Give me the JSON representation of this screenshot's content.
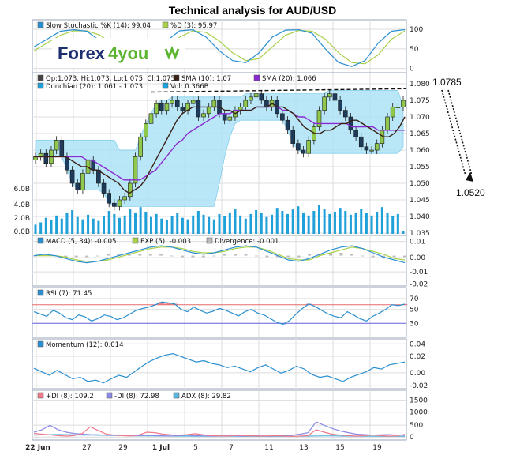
{
  "title": "Technical analysis for AUD/USD",
  "logo": {
    "part1": "Forex",
    "part2": "4you"
  },
  "annotations": {
    "upper": "1.0785",
    "lower": "1.0520"
  },
  "x_tick_labels": [
    "22 Jun",
    "27",
    "29",
    "1 Jul",
    "5",
    "7",
    "11",
    "13",
    "15",
    "19"
  ],
  "colors": {
    "bull": "#8fc84a",
    "bear": "#1f3b5b",
    "donchian": "#aee3f7",
    "sma10": "#3a2016",
    "sma20": "#8a2ad0",
    "volume": "#20a0d8",
    "grid": "#dcdcdc",
    "panel_border": "#9aa6b8",
    "k_line": "#2a8fd0",
    "d_line": "#a8d04a",
    "rsi_line": "#2a8fd0",
    "rsi_over": "#e66a6a",
    "rsi_under": "#6a6ae6",
    "plus_di": "#f07a8a",
    "minus_di": "#8a8ae6",
    "adx": "#5ab8e0"
  },
  "chart_data": [
    {
      "id": "stochastic",
      "type": "line",
      "legend": [
        "Slow Stochastic %K (14): 99.04",
        "%D (3): 95.97"
      ],
      "ylim": [
        0,
        100
      ],
      "y_ticks": [
        "100",
        "50",
        "0"
      ],
      "series": [
        {
          "name": "Slow Stochastic %K (14)",
          "values": [
            55,
            75,
            95,
            99,
            95,
            70,
            35,
            10,
            8,
            30,
            70,
            96,
            99,
            80,
            45,
            20,
            15,
            40,
            80,
            98,
            99,
            90,
            50,
            15,
            5,
            20,
            65,
            95,
            99.04
          ]
        },
        {
          "name": "%D (3)",
          "values": [
            45,
            65,
            85,
            96,
            96,
            85,
            60,
            30,
            15,
            20,
            45,
            80,
            96,
            92,
            70,
            40,
            20,
            25,
            55,
            85,
            97,
            95,
            75,
            40,
            15,
            12,
            35,
            75,
            95.97
          ]
        }
      ]
    },
    {
      "id": "price",
      "type": "candlestick",
      "legend": [
        "Op:1.073, Hi:1.073, Lo:1.075, Cl:1.075",
        "SMA (10): 1.07",
        "SMA (20): 1.066",
        "Donchian (20): 1.061 - 1.073",
        "Vol: 0.366B"
      ],
      "ylim": [
        1.035,
        1.08
      ],
      "y_ticks": [
        "1.080",
        "1.075",
        "1.070",
        "1.065",
        "1.060",
        "1.055",
        "1.050",
        "1.045",
        "1.040",
        "1.035"
      ],
      "volume_ticks": [
        "6.0B",
        "4.0B",
        "2.0B",
        "0.0B"
      ],
      "close": [
        1.058,
        1.059,
        1.056,
        1.06,
        1.063,
        1.058,
        1.054,
        1.05,
        1.048,
        1.053,
        1.057,
        1.054,
        1.05,
        1.047,
        1.044,
        1.043,
        1.045,
        1.046,
        1.05,
        1.058,
        1.064,
        1.068,
        1.071,
        1.074,
        1.072,
        1.074,
        1.075,
        1.073,
        1.072,
        1.074,
        1.075,
        1.07,
        1.071,
        1.073,
        1.075,
        1.071,
        1.069,
        1.07,
        1.072,
        1.073,
        1.075,
        1.076,
        1.077,
        1.075,
        1.073,
        1.075,
        1.071,
        1.069,
        1.066,
        1.062,
        1.06,
        1.059,
        1.063,
        1.067,
        1.072,
        1.076,
        1.077,
        1.075,
        1.072,
        1.07,
        1.066,
        1.064,
        1.061,
        1.06,
        1.06,
        1.062,
        1.066,
        1.07,
        1.073,
        1.073,
        1.075
      ],
      "sma10": [
        1.058,
        1.058,
        1.058,
        1.058,
        1.058,
        1.058,
        1.058,
        1.057,
        1.056,
        1.055,
        1.055,
        1.054,
        1.054,
        1.053,
        1.052,
        1.051,
        1.05,
        1.048,
        1.047,
        1.048,
        1.049,
        1.051,
        1.054,
        1.057,
        1.06,
        1.063,
        1.066,
        1.069,
        1.071,
        1.072,
        1.073,
        1.073,
        1.073,
        1.073,
        1.073,
        1.073,
        1.072,
        1.072,
        1.071,
        1.072,
        1.072,
        1.072,
        1.073,
        1.073,
        1.073,
        1.074,
        1.073,
        1.073,
        1.072,
        1.071,
        1.069,
        1.067,
        1.066,
        1.065,
        1.065,
        1.066,
        1.066,
        1.067,
        1.068,
        1.068,
        1.069,
        1.069,
        1.068,
        1.067,
        1.066,
        1.065,
        1.064,
        1.064,
        1.065,
        1.067,
        1.07
      ],
      "sma20": [
        1.058,
        1.058,
        1.058,
        1.058,
        1.058,
        1.058,
        1.058,
        1.058,
        1.058,
        1.058,
        1.057,
        1.057,
        1.056,
        1.055,
        1.054,
        1.053,
        1.052,
        1.051,
        1.051,
        1.051,
        1.051,
        1.052,
        1.053,
        1.054,
        1.056,
        1.058,
        1.06,
        1.062,
        1.063,
        1.065,
        1.066,
        1.067,
        1.068,
        1.069,
        1.07,
        1.071,
        1.071,
        1.071,
        1.072,
        1.072,
        1.072,
        1.072,
        1.073,
        1.073,
        1.073,
        1.073,
        1.073,
        1.072,
        1.072,
        1.071,
        1.07,
        1.07,
        1.069,
        1.068,
        1.068,
        1.068,
        1.068,
        1.068,
        1.068,
        1.068,
        1.067,
        1.067,
        1.067,
        1.067,
        1.067,
        1.066,
        1.066,
        1.066,
        1.066,
        1.066,
        1.066
      ],
      "donchian_upper": [
        1.063,
        1.063,
        1.063,
        1.063,
        1.063,
        1.063,
        1.063,
        1.063,
        1.063,
        1.063,
        1.063,
        1.063,
        1.063,
        1.063,
        1.063,
        1.063,
        1.06,
        1.06,
        1.06,
        1.06,
        1.064,
        1.068,
        1.071,
        1.074,
        1.075,
        1.075,
        1.076,
        1.076,
        1.076,
        1.076,
        1.076,
        1.076,
        1.076,
        1.076,
        1.076,
        1.076,
        1.076,
        1.076,
        1.076,
        1.076,
        1.077,
        1.077,
        1.077,
        1.077,
        1.077,
        1.077,
        1.077,
        1.077,
        1.077,
        1.077,
        1.077,
        1.077,
        1.077,
        1.077,
        1.077,
        1.077,
        1.078,
        1.078,
        1.078,
        1.078,
        1.078,
        1.078,
        1.078,
        1.078,
        1.078,
        1.078,
        1.078,
        1.078,
        1.078,
        1.078,
        1.073
      ],
      "donchian_lower": [
        1.058,
        1.058,
        1.058,
        1.058,
        1.058,
        1.058,
        1.054,
        1.05,
        1.048,
        1.048,
        1.048,
        1.048,
        1.048,
        1.047,
        1.044,
        1.043,
        1.043,
        1.043,
        1.043,
        1.043,
        1.043,
        1.043,
        1.043,
        1.043,
        1.043,
        1.043,
        1.043,
        1.043,
        1.043,
        1.043,
        1.043,
        1.043,
        1.043,
        1.043,
        1.043,
        1.05,
        1.058,
        1.064,
        1.068,
        1.069,
        1.069,
        1.069,
        1.069,
        1.069,
        1.069,
        1.069,
        1.069,
        1.069,
        1.066,
        1.062,
        1.06,
        1.059,
        1.059,
        1.059,
        1.059,
        1.059,
        1.059,
        1.059,
        1.059,
        1.059,
        1.059,
        1.059,
        1.059,
        1.059,
        1.059,
        1.059,
        1.059,
        1.059,
        1.059,
        1.059,
        1.061
      ],
      "volume": [
        1.2,
        1.5,
        2.1,
        1.8,
        2.4,
        2.0,
        2.8,
        3.1,
        2.2,
        1.9,
        2.5,
        2.0,
        1.7,
        2.3,
        3.0,
        2.6,
        2.1,
        2.4,
        3.2,
        2.8,
        3.5,
        2.9,
        2.2,
        2.6,
        2.0,
        1.8,
        2.3,
        2.7,
        2.1,
        1.9,
        2.4,
        3.0,
        2.5,
        2.2,
        1.9,
        2.6,
        2.3,
        2.8,
        3.2,
        2.4,
        2.0,
        2.6,
        3.1,
        2.7,
        2.2,
        2.5,
        3.4,
        3.0,
        2.6,
        3.2,
        3.6,
        2.8,
        2.4,
        3.0,
        3.8,
        3.2,
        2.6,
        2.9,
        3.4,
        3.0,
        2.5,
        2.8,
        3.3,
        2.7,
        2.4,
        2.9,
        3.5,
        2.8,
        2.3,
        2.6,
        0.366
      ]
    },
    {
      "id": "macd",
      "type": "line",
      "legend": [
        "MACD (5, 34): -0.005",
        "EXP (5): -0.003",
        "Divergence: -0.001"
      ],
      "ylim": [
        -0.02,
        0.01
      ],
      "y_ticks": [
        "0.01",
        "0.00",
        "-0.01",
        "-0.02"
      ],
      "series": [
        {
          "name": "MACD (5, 34)",
          "values": [
            0.0,
            0.001,
            0.0,
            -0.002,
            -0.004,
            -0.005,
            -0.004,
            -0.002,
            0.0,
            0.002,
            0.004,
            0.006,
            0.007,
            0.006,
            0.004,
            0.002,
            0.001,
            0.002,
            0.004,
            0.006,
            0.007,
            0.006,
            0.003,
            0.0,
            -0.003,
            -0.004,
            -0.002,
            0.001,
            0.004,
            0.006,
            0.007,
            0.005,
            0.002,
            -0.001,
            -0.003,
            -0.005
          ]
        },
        {
          "name": "EXP (5)",
          "values": [
            0.0,
            0.0,
            0.0,
            -0.001,
            -0.003,
            -0.004,
            -0.004,
            -0.003,
            -0.001,
            0.001,
            0.003,
            0.005,
            0.006,
            0.006,
            0.005,
            0.003,
            0.002,
            0.002,
            0.003,
            0.005,
            0.006,
            0.006,
            0.004,
            0.001,
            -0.002,
            -0.003,
            -0.003,
            0.0,
            0.002,
            0.004,
            0.006,
            0.005,
            0.003,
            0.001,
            -0.002,
            -0.003
          ]
        },
        {
          "name": "Divergence",
          "values": [
            0.0,
            0.001,
            0.0,
            -0.001,
            -0.001,
            -0.001,
            0.0,
            0.001,
            0.001,
            0.001,
            0.001,
            0.001,
            0.001,
            0.0,
            -0.001,
            -0.001,
            -0.001,
            0.0,
            0.001,
            0.001,
            0.001,
            0.0,
            -0.001,
            -0.001,
            -0.001,
            -0.001,
            0.001,
            0.001,
            0.002,
            0.002,
            0.001,
            0.0,
            -0.001,
            -0.002,
            -0.001,
            -0.001
          ]
        }
      ]
    },
    {
      "id": "rsi",
      "type": "line",
      "legend": [
        "RSI (7): 71.45"
      ],
      "ylim": [
        10,
        90
      ],
      "y_ticks": [
        "70",
        "50",
        "30"
      ],
      "levels": [
        70,
        30
      ],
      "series": [
        {
          "name": "RSI (7)",
          "values": [
            55,
            50,
            45,
            58,
            52,
            42,
            38,
            48,
            44,
            35,
            40,
            48,
            45,
            38,
            42,
            50,
            58,
            62,
            65,
            70,
            76,
            74,
            72,
            60,
            55,
            65,
            58,
            52,
            56,
            62,
            58,
            52,
            46,
            55,
            60,
            52,
            48,
            40,
            32,
            28,
            36,
            50,
            62,
            72,
            66,
            58,
            50,
            45,
            42,
            55,
            48,
            40,
            35,
            45,
            52,
            60,
            70,
            68,
            71.45
          ]
        }
      ]
    },
    {
      "id": "momentum",
      "type": "line",
      "legend": [
        "Momentum (12): 0.014"
      ],
      "ylim": [
        -0.02,
        0.04
      ],
      "y_ticks": [
        "0.04",
        "0.02",
        "0.00",
        "-0.02"
      ],
      "series": [
        {
          "name": "Momentum (12)",
          "values": [
            0.005,
            0.0,
            -0.005,
            0.002,
            -0.004,
            -0.01,
            -0.008,
            -0.014,
            -0.012,
            -0.016,
            -0.01,
            -0.005,
            -0.008,
            0.0,
            0.008,
            0.015,
            0.02,
            0.024,
            0.026,
            0.022,
            0.018,
            0.014,
            0.016,
            0.012,
            0.01,
            0.006,
            0.008,
            0.004,
            0.0,
            0.006,
            0.01,
            0.004,
            -0.002,
            0.002,
            0.008,
            0.004,
            -0.004,
            -0.008,
            -0.006,
            -0.01,
            -0.014,
            -0.008,
            -0.004,
            0.0,
            0.006,
            0.004,
            0.01,
            0.012,
            0.014
          ]
        }
      ]
    },
    {
      "id": "adx",
      "type": "line",
      "legend": [
        "+DI (8): 109.2",
        "-DI (8): 72.98",
        "ADX (8): 29.82"
      ],
      "ylim": [
        0,
        1500
      ],
      "y_ticks": [
        "1500",
        "1000",
        "500",
        "0"
      ],
      "series": [
        {
          "name": "+DI (8)",
          "values": [
            150,
            120,
            90,
            60,
            40,
            60,
            150,
            420,
            260,
            120,
            80,
            60,
            50,
            80,
            200,
            180,
            120,
            90,
            80,
            100,
            140,
            90,
            60,
            50,
            40,
            70,
            60,
            50,
            40,
            50,
            60,
            40,
            30,
            40,
            60,
            300,
            200,
            120,
            80,
            60,
            40,
            60,
            80,
            60,
            40,
            50,
            109.2
          ]
        },
        {
          "name": "-DI (8)",
          "values": [
            200,
            300,
            480,
            300,
            200,
            150,
            120,
            100,
            90,
            80,
            70,
            60,
            50,
            60,
            70,
            60,
            50,
            40,
            60,
            80,
            60,
            50,
            40,
            50,
            60,
            50,
            40,
            60,
            50,
            40,
            50,
            60,
            70,
            120,
            180,
            620,
            480,
            350,
            250,
            180,
            120,
            100,
            80,
            90,
            100,
            85,
            72.98
          ]
        },
        {
          "name": "ADX (8)",
          "values": [
            80,
            90,
            100,
            110,
            100,
            90,
            85,
            80,
            75,
            70,
            65,
            60,
            55,
            50,
            48,
            46,
            44,
            42,
            40,
            38,
            36,
            35,
            34,
            33,
            32,
            32,
            31,
            31,
            30,
            30,
            30,
            31,
            32,
            34,
            38,
            45,
            50,
            48,
            44,
            40,
            36,
            34,
            32,
            31,
            30,
            30,
            29.82
          ]
        }
      ]
    }
  ]
}
